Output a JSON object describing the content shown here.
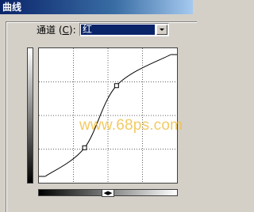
{
  "window": {
    "title": "曲线"
  },
  "channel": {
    "label_prefix": "通道 (",
    "label_key": "C",
    "label_suffix": "):",
    "selected": "红"
  },
  "curve": {
    "control_points": [
      {
        "input": 0,
        "output": 0
      },
      {
        "input": 80,
        "output": 60
      },
      {
        "input": 145,
        "output": 190
      },
      {
        "input": 255,
        "output": 255
      }
    ],
    "grid_divisions": 4
  },
  "watermark": "www.68ps.com",
  "toggle_glyph": "◀▶"
}
